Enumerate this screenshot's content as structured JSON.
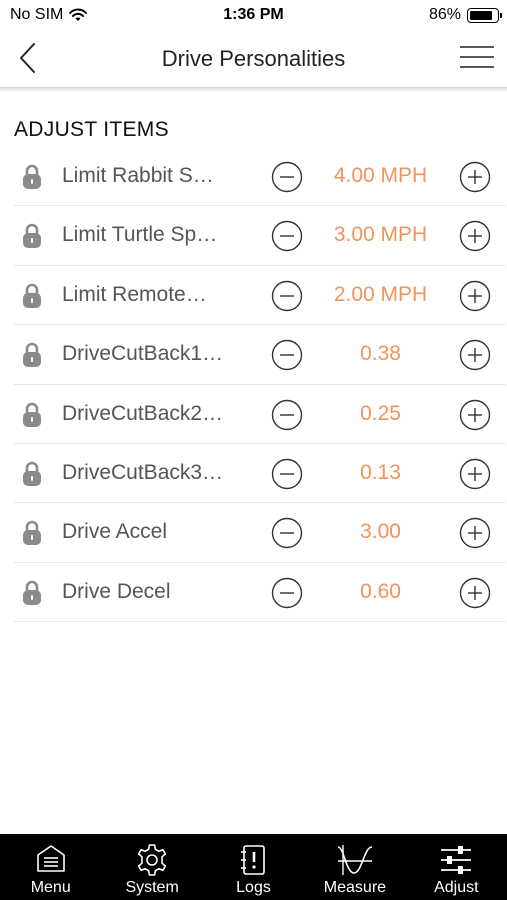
{
  "status_bar": {
    "carrier": "No SIM",
    "time": "1:36 PM",
    "battery_percent": "86%",
    "battery_level": 0.86
  },
  "nav": {
    "title": "Drive Personalities"
  },
  "section": {
    "title": "ADJUST ITEMS"
  },
  "items": [
    {
      "label": "Limit Rabbit S…",
      "value": "4.00 MPH"
    },
    {
      "label": "Limit Turtle Sp…",
      "value": "3.00 MPH"
    },
    {
      "label": "Limit Remote…",
      "value": "2.00 MPH"
    },
    {
      "label": "DriveCutBack1…",
      "value": "0.38"
    },
    {
      "label": "DriveCutBack2…",
      "value": "0.25"
    },
    {
      "label": "DriveCutBack3…",
      "value": "0.13"
    },
    {
      "label": "Drive Accel",
      "value": "3.00"
    },
    {
      "label": "Drive Decel",
      "value": "0.60"
    }
  ],
  "tabs": [
    {
      "label": "Menu",
      "icon": "menu-icon"
    },
    {
      "label": "System",
      "icon": "gear-icon"
    },
    {
      "label": "Logs",
      "icon": "logs-icon"
    },
    {
      "label": "Measure",
      "icon": "measure-icon"
    },
    {
      "label": "Adjust",
      "icon": "sliders-icon"
    }
  ],
  "colors": {
    "accent": "#f0935e",
    "tab_bar": "#000000",
    "label": "#555555"
  }
}
